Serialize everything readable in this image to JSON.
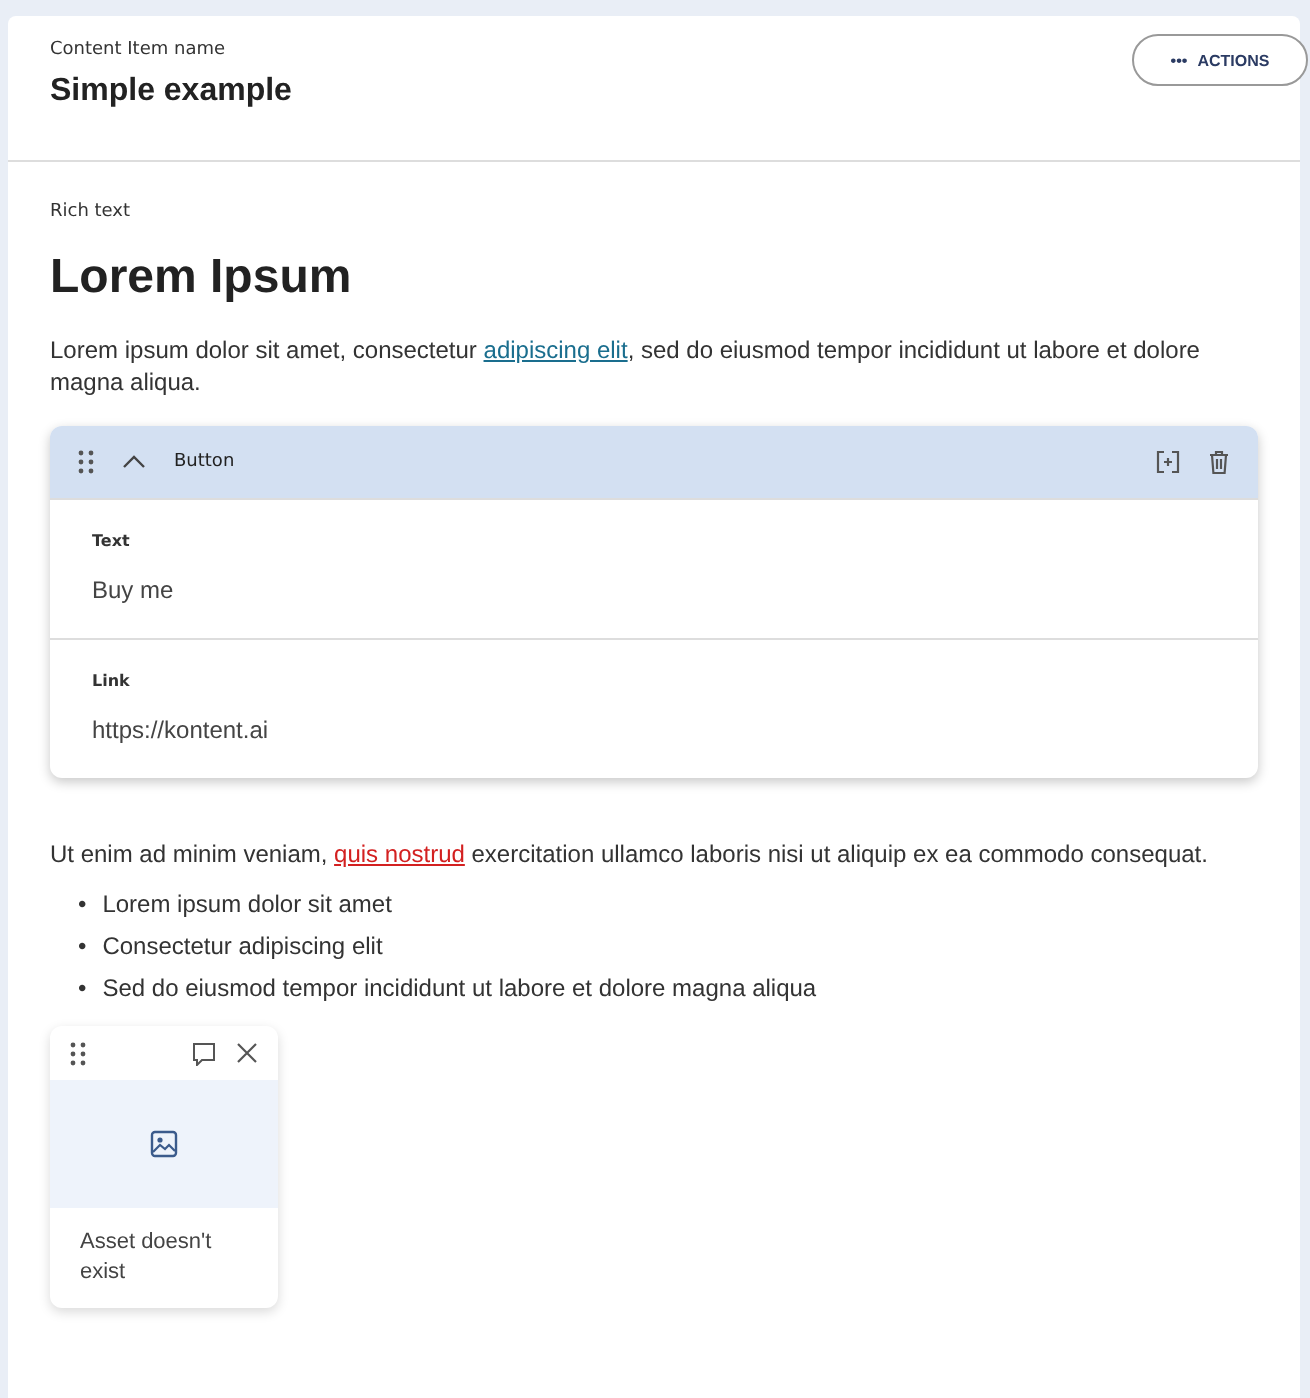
{
  "header": {
    "label": "Content Item name",
    "title": "Simple example",
    "actions": {
      "icon": "•••",
      "label": "ACTIONS"
    }
  },
  "rich_text": {
    "label": "Rich text",
    "heading": "Lorem Ipsum",
    "paragraph_1": [
      {
        "kind": "plain",
        "text": "Lorem ipsum dolor sit amet, consectetur "
      },
      {
        "kind": "link",
        "text": "adipiscing elit"
      },
      {
        "kind": "plain",
        "text": ", sed do eiusmod tempor incididunt ut labore et dolore magna aliqua."
      }
    ],
    "component": {
      "title": "Button",
      "expanded": true,
      "fields": [
        {
          "label": "Text",
          "value": "Buy me"
        },
        {
          "label": "Link",
          "value": "https://kontent.ai"
        }
      ]
    },
    "paragraph_2": [
      {
        "kind": "plain",
        "text": "Ut enim ad minim veniam, "
      },
      {
        "kind": "broken-link",
        "text": "quis nostrud"
      },
      {
        "kind": "plain",
        "text": " exercitation ullamco laboris nisi ut aliquip ex ea commodo consequat."
      }
    ],
    "list": [
      {
        "bullet": "•",
        "text": "Lorem ipsum dolor sit amet"
      },
      {
        "bullet": "•",
        "text": "Consectetur adipiscing elit"
      },
      {
        "bullet": "•",
        "text": "Sed do eiusmod tempor incididunt ut labore et dolore magna aliqua"
      }
    ],
    "asset": {
      "message": "Asset doesn't exist"
    }
  }
}
